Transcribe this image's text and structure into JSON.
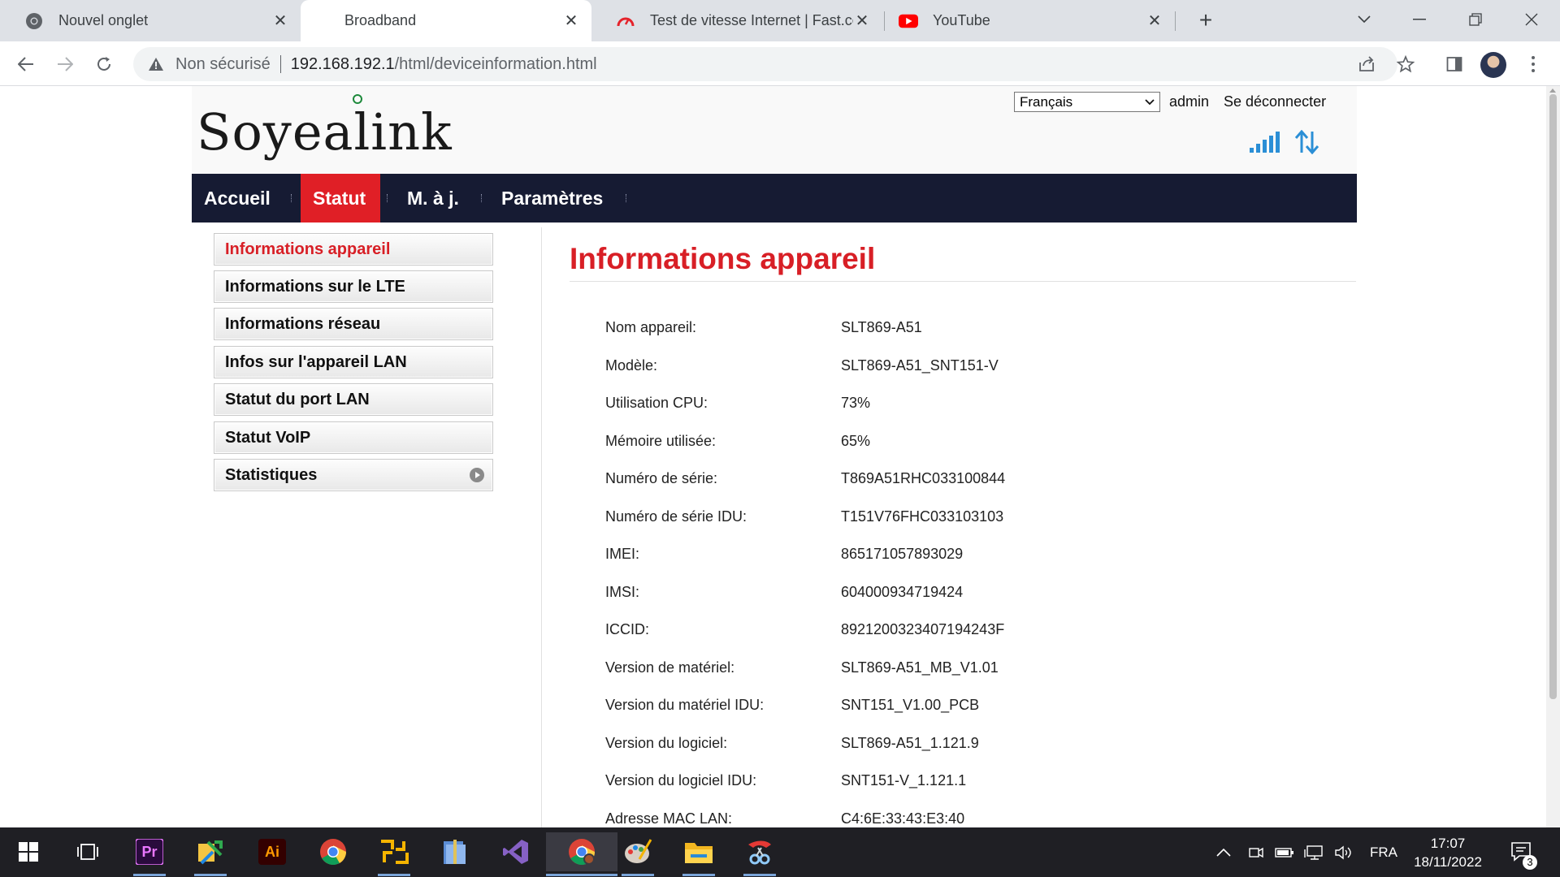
{
  "browser": {
    "tabs": [
      {
        "title": "Nouvel onglet",
        "icon": "chrome-icon"
      },
      {
        "title": "Broadband",
        "icon": "none"
      },
      {
        "title": "Test de vitesse Internet | Fast.com",
        "icon": "fast-speedometer-icon"
      },
      {
        "title": "YouTube",
        "icon": "youtube-icon"
      }
    ],
    "close_glyph": "✕",
    "new_tab_glyph": "+",
    "address": {
      "security_text": "Non sécurisé",
      "host": "192.168.192.1",
      "path": "/html/deviceinformation.html"
    }
  },
  "router": {
    "brand": "Soyealink",
    "language": "Français",
    "user": "admin",
    "logout": "Se déconnecter",
    "nav": [
      "Accueil",
      "Statut",
      "M. à j.",
      "Paramètres"
    ],
    "sidebar": [
      "Informations appareil",
      "Informations sur le LTE",
      "Informations réseau",
      "Infos sur l'appareil LAN",
      "Statut du port LAN",
      "Statut VoIP",
      "Statistiques"
    ],
    "page_title": "Informations appareil",
    "info": [
      {
        "label": "Nom appareil:",
        "value": "SLT869-A51"
      },
      {
        "label": "Modèle:",
        "value": "SLT869-A51_SNT151-V"
      },
      {
        "label": "Utilisation CPU:",
        "value": "73%"
      },
      {
        "label": "Mémoire utilisée:",
        "value": "65%"
      },
      {
        "label": "Numéro de série:",
        "value": "T869A51RHC033100844"
      },
      {
        "label": "Numéro de série IDU:",
        "value": "T151V76FHC033103103"
      },
      {
        "label": "IMEI:",
        "value": "865171057893029"
      },
      {
        "label": "IMSI:",
        "value": "604000934719424"
      },
      {
        "label": "ICCID:",
        "value": "8921200323407194243F"
      },
      {
        "label": "Version de matériel:",
        "value": "SLT869-A51_MB_V1.01"
      },
      {
        "label": "Version du matériel IDU:",
        "value": "SNT151_V1.00_PCB"
      },
      {
        "label": "Version du logiciel:",
        "value": "SLT869-A51_1.121.9"
      },
      {
        "label": "Version du logiciel IDU:",
        "value": "SNT151-V_1.121.1"
      },
      {
        "label": "Adresse MAC LAN:",
        "value": "C4:6E:33:43:E3:40"
      }
    ],
    "accent_color": "#d81f26",
    "nav_color": "#161b33"
  },
  "taskbar": {
    "apps": [
      "windows-start-icon",
      "task-view-icon",
      "premiere-pro-icon",
      "file-transfer-icon",
      "illustrator-icon",
      "chrome-icon",
      "network-tool-icon",
      "archive-icon",
      "visual-studio-icon",
      "chrome-active-icon",
      "paint-icon",
      "file-explorer-icon",
      "snipping-tool-icon"
    ],
    "premiere_label": "Pr",
    "illustrator_label": "Ai",
    "language": "FRA",
    "time": "17:07",
    "date": "18/11/2022",
    "notifications": "3"
  }
}
